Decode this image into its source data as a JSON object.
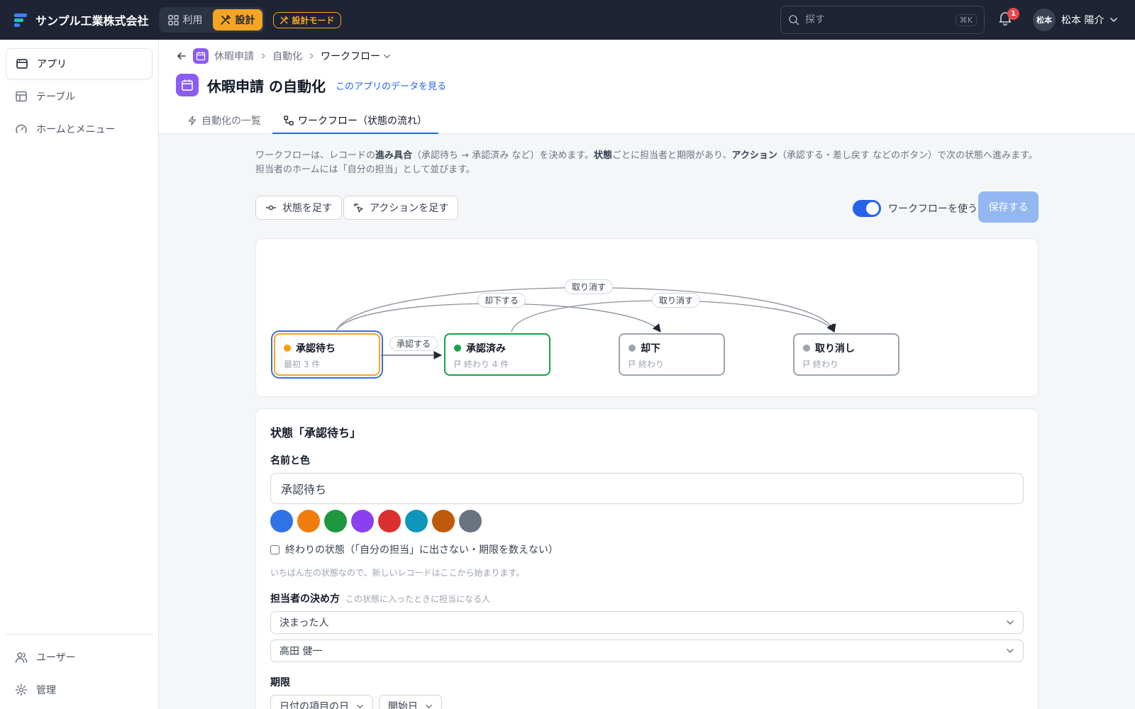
{
  "topbar": {
    "company": "サンプル工業株式会社",
    "modes": [
      {
        "label": "利用",
        "icon": "grid-icon"
      },
      {
        "label": "設計",
        "icon": "tools-icon"
      }
    ],
    "mode_badge": "設計モード",
    "search_placeholder": "探す",
    "search_shortcut": "⌘K",
    "notification_count": "1",
    "avatar_text": "松本",
    "user_name": "松本 陽介"
  },
  "sidebar": {
    "items": [
      {
        "label": "アプリ",
        "icon": "app-window-icon"
      },
      {
        "label": "テーブル",
        "icon": "table-icon"
      },
      {
        "label": "ホームとメニュー",
        "icon": "gauge-icon"
      }
    ],
    "bottom_items": [
      {
        "label": "ユーザー",
        "icon": "users-icon"
      },
      {
        "label": "管理",
        "icon": "gear-icon"
      }
    ]
  },
  "breadcrumb": {
    "app": "休暇申請",
    "section": "自動化",
    "current": "ワークフロー"
  },
  "page": {
    "title": "休暇申請 の自動化",
    "data_link": "このアプリのデータを見る"
  },
  "tabs": [
    {
      "label": "自動化の一覧",
      "icon": "bolt-icon"
    },
    {
      "label": "ワークフロー（状態の流れ）",
      "icon": "flow-icon"
    }
  ],
  "description": {
    "p1": "ワークフローは、レコードの",
    "b1": "進み具合",
    "p2": "（承認待ち → 承認済み など）を決めます。",
    "b2": "状態",
    "p3": "ごとに担当者と期限があり、",
    "b3": "アクション",
    "p4": "（承認する・差し戻す などのボタン）で次の状態へ進みます。担当者のホームには「自分の担当」として並びます。"
  },
  "toolbar": {
    "add_state": "状態を足す",
    "add_action": "アクションを足す",
    "toggle_label": "ワークフローを使う",
    "save": "保存する"
  },
  "workflow": {
    "states": [
      {
        "name": "承認待ち",
        "sub": "最初  3 件",
        "color": "#f59e0b",
        "border": "#f5a524"
      },
      {
        "name": "承認済み",
        "sub": "終わり  4 件",
        "color": "#16a34a",
        "border": "#16a34a"
      },
      {
        "name": "却下",
        "sub": "終わり",
        "color": "#9ca3af",
        "border": "#9ca3af"
      },
      {
        "name": "取り消し",
        "sub": "終わり",
        "color": "#9ca3af",
        "border": "#9ca3af"
      }
    ],
    "actions": [
      {
        "label": "承認する"
      },
      {
        "label": "却下する"
      },
      {
        "label": "取り消す"
      },
      {
        "label": "取り消す"
      }
    ]
  },
  "form": {
    "title": "状態「承認待ち」",
    "name_label": "名前と色",
    "name_value": "承認待ち",
    "swatches": [
      "#2f73e6",
      "#f07c0e",
      "#1f9740",
      "#8a3ff0",
      "#dc2f2f",
      "#0e96bb",
      "#c05a0b",
      "#6b7280"
    ],
    "final_check": "終わりの状態（「自分の担当」に出さない・期限を数えない）",
    "start_note": "いちばん左の状態なので、新しいレコードはここから始まります。",
    "assignee_label": "担当者の決め方",
    "assignee_hint": "この状態に入ったときに担当になる人",
    "assignee_mode": "決まった人",
    "assignee_person": "高田 健一",
    "deadline_label": "期限",
    "deadline_type": "日付の項目の日",
    "deadline_field": "開始日"
  }
}
